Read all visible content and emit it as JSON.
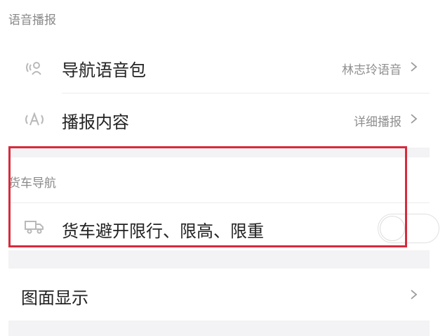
{
  "sections": {
    "voice": {
      "header": "语音播报",
      "items": [
        {
          "label": "导航语音包",
          "value": "林志玲语音"
        },
        {
          "label": "播报内容",
          "value": "详细播报"
        }
      ]
    },
    "truck": {
      "header": "货车导航",
      "item": {
        "label": "货车避开限行、限高、限重",
        "toggle_on": false
      }
    },
    "display": {
      "item": {
        "label": "图面显示"
      }
    }
  },
  "icons": {
    "voice_pack": "voice-pack-icon",
    "broadcast": "broadcast-icon",
    "truck": "truck-icon",
    "chevron": "chevron-right-icon"
  },
  "colors": {
    "highlight": "#d62b3c",
    "section_bg": "#f3f3f5",
    "text_primary": "#222222",
    "text_secondary": "#8f8f8f"
  }
}
